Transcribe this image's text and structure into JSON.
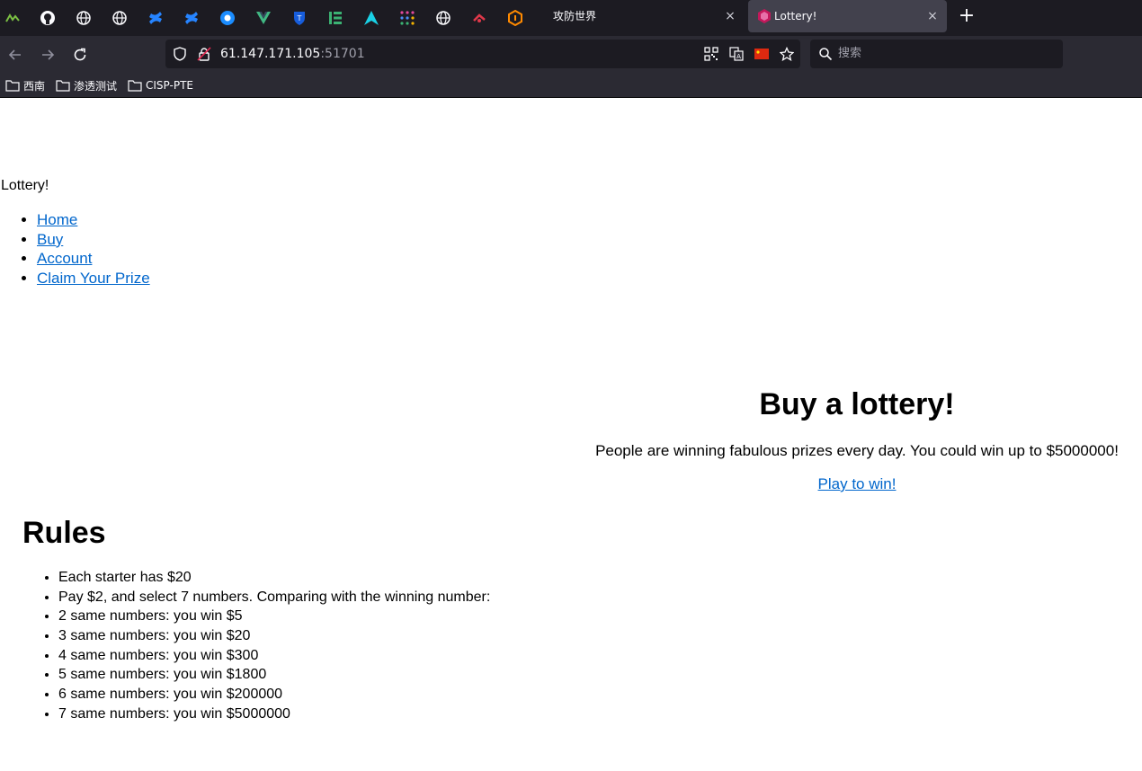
{
  "browser": {
    "tabs": [
      {
        "label": "攻防世界",
        "active": false
      },
      {
        "label": "Lottery!",
        "active": true
      }
    ],
    "new_tab_label": "+",
    "close_glyph": "×",
    "url_host": "61.147.171.105",
    "url_port": ":51701",
    "search_placeholder": "搜索",
    "bookmarks": [
      {
        "label": "西南"
      },
      {
        "label": "渗透测试"
      },
      {
        "label": "CISP-PTE"
      }
    ],
    "icons": [
      "github-icon",
      "globe-icon",
      "confluence-icon",
      "chrome-icon",
      "vue-icon",
      "bitwarden-icon",
      "elementor-icon",
      "arch-icon",
      "grid-icon",
      "tomato-icon",
      "lottery-favicon"
    ],
    "accent_color": "#0066cc"
  },
  "page": {
    "site_title": "Lottery!",
    "nav": [
      {
        "label": "Home"
      },
      {
        "label": "Buy"
      },
      {
        "label": "Account"
      },
      {
        "label": "Claim Your Prize"
      }
    ],
    "hero": {
      "heading": "Buy a lottery!",
      "text": "People are winning fabulous prizes every day. You could win up to $5000000!",
      "cta": "Play to win!"
    },
    "rules": {
      "heading": "Rules",
      "items": [
        "Each starter has $20",
        "Pay $2, and select 7 numbers. Comparing with the winning number:",
        "2 same numbers: you win $5",
        "3 same numbers: you win $20",
        "4 same numbers: you win $300",
        "5 same numbers: you win $1800",
        "6 same numbers: you win $200000",
        "7 same numbers: you win $5000000"
      ]
    }
  }
}
